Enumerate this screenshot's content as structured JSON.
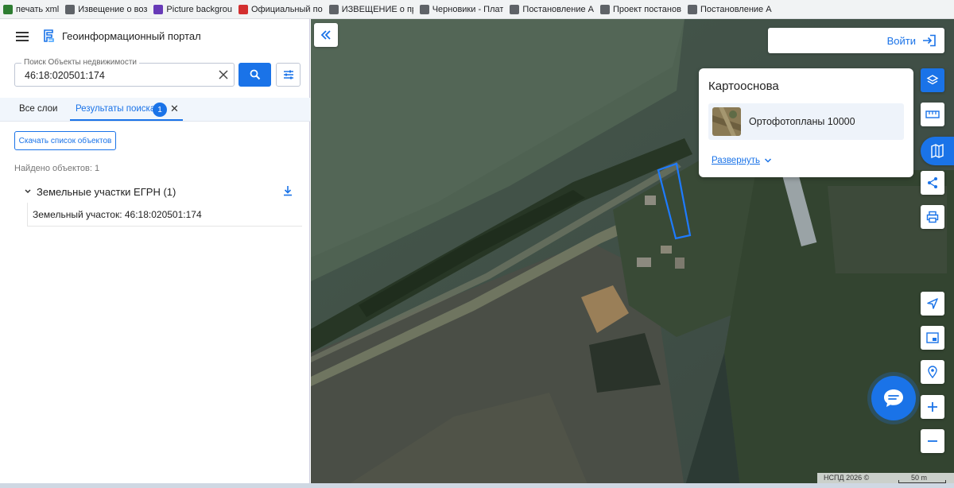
{
  "bookmarks": [
    {
      "label": "печать xml",
      "color": "#2e7d32"
    },
    {
      "label": "Извещение о воз",
      "color": "#5f6368"
    },
    {
      "label": "Picture backgrou",
      "color": "#673ab7"
    },
    {
      "label": "Официальный по",
      "color": "#d32f2f"
    },
    {
      "label": "ИЗВЕЩЕНИЕ о пр",
      "color": "#5f6368"
    },
    {
      "label": "Черновики - Плат",
      "color": "#5f6368"
    },
    {
      "label": "Постановление А",
      "color": "#5f6368"
    },
    {
      "label": "Проект постанов",
      "color": "#5f6368"
    },
    {
      "label": "Постановление А",
      "color": "#5f6368"
    }
  ],
  "header": {
    "title": "Геоинформационный портал"
  },
  "search": {
    "label": "Поиск Объекты недвижимости",
    "value": "46:18:020501:174"
  },
  "tabs": {
    "all": "Все слои",
    "results": "Результаты поиска",
    "count": "1"
  },
  "results": {
    "download_list": "Скачать список объектов",
    "found": "Найдено объектов: 1",
    "group": "Земельные участки ЕГРН (1)",
    "item": "Земельный участок: 46:18:020501:174"
  },
  "map": {
    "login": "Войти",
    "basemap_title": "Картооснова",
    "basemap_option": "Ортофотопланы 10000",
    "expand": "Развернуть",
    "attribution": "НСПД 2026 ©",
    "scale": "50 m"
  },
  "colors": {
    "accent": "#1a73e8",
    "parcel_outline": "#1e7bff"
  }
}
